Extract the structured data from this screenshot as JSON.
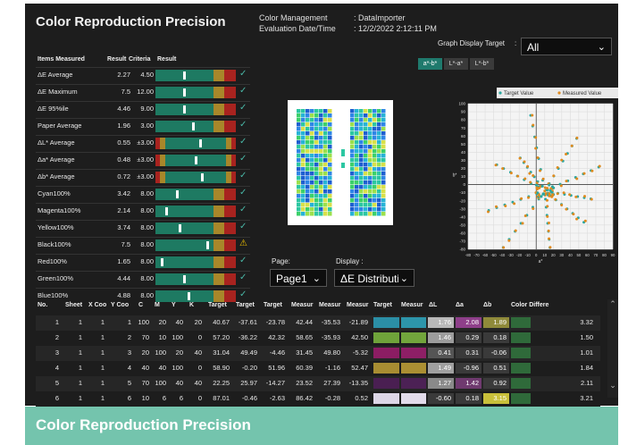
{
  "title": "Color Reproduction Precision",
  "header": {
    "color_management_label": "Color Management",
    "color_management_value": ": DataImporter",
    "evaluation_label": "Evaluation Date/Time",
    "evaluation_value": ": 12/2/2022 2:12:11 PM",
    "graph_target_label": "Graph Display Target",
    "graph_target_colon": ":",
    "graph_target_value": "All"
  },
  "graph_tabs": [
    "a*-b*",
    "L*-a*",
    "L*-b*"
  ],
  "measured_table": {
    "columns": [
      "Items Measured",
      "Result",
      "Criteria",
      "Result"
    ],
    "rows": [
      {
        "label": "ΔE Average",
        "result": "2.27",
        "criteria": "4.50",
        "pos": 0.36,
        "status": "✓"
      },
      {
        "label": "ΔE Maximum",
        "result": "7.5",
        "criteria": "12.00",
        "pos": 0.36,
        "status": "✓"
      },
      {
        "label": "ΔE 95%ile",
        "result": "4.46",
        "criteria": "9.00",
        "pos": 0.36,
        "status": "✓"
      },
      {
        "label": "Paper Average",
        "result": "1.96",
        "criteria": "3.00",
        "pos": 0.47,
        "status": "✓"
      },
      {
        "label": "ΔL* Average",
        "result": "0.55",
        "criteria": "±3.00",
        "pos": 0.55,
        "status": "✓"
      },
      {
        "label": "Δa* Average",
        "result": "0.48",
        "criteria": "±3.00",
        "pos": 0.5,
        "status": "✓"
      },
      {
        "label": "Δb* Average",
        "result": "0.72",
        "criteria": "±3.00",
        "pos": 0.58,
        "status": "✓"
      },
      {
        "label": "Cyan100%",
        "result": "3.42",
        "criteria": "8.00",
        "pos": 0.27,
        "status": "✓"
      },
      {
        "label": "Magenta100%",
        "result": "2.14",
        "criteria": "8.00",
        "pos": 0.13,
        "status": "✓"
      },
      {
        "label": "Yellow100%",
        "result": "3.74",
        "criteria": "8.00",
        "pos": 0.3,
        "status": "✓"
      },
      {
        "label": "Black100%",
        "result": "7.5",
        "criteria": "8.00",
        "pos": 0.64,
        "status": "⚠"
      },
      {
        "label": "Red100%",
        "result": "1.65",
        "criteria": "8.00",
        "pos": 0.08,
        "status": "✓"
      },
      {
        "label": "Green100%",
        "result": "4.44",
        "criteria": "8.00",
        "pos": 0.36,
        "status": "✓"
      },
      {
        "label": "Blue100%",
        "result": "4.88",
        "criteria": "8.00",
        "pos": 0.41,
        "status": "✓"
      }
    ]
  },
  "page_selector": {
    "label": "Page:",
    "value": "Page1"
  },
  "display_selector": {
    "label": "Display :",
    "value": "ΔE Distributio"
  },
  "chart_data": {
    "type": "scatter",
    "series": [
      {
        "name": "Target Value",
        "color": "#2aa7a0"
      },
      {
        "name": "Measured Value",
        "color": "#e08a1e"
      }
    ],
    "xlim": [
      -80,
      90
    ],
    "ylim": [
      -80,
      100
    ],
    "xticks": [
      "-80",
      "-70",
      "-60",
      "-50",
      "-40",
      "-30",
      "-20",
      "-10",
      "0",
      "10",
      "20",
      "30",
      "40",
      "50",
      "60",
      "70",
      "80",
      "90"
    ],
    "yticks": [
      "100",
      "90",
      "80",
      "70",
      "60",
      "50",
      "40",
      "30",
      "20",
      "10",
      "0",
      "-10",
      "-20",
      "-30",
      "-40",
      "-50",
      "-60",
      "-70",
      "-80"
    ],
    "xlabel": "a*",
    "ylabel": "b*",
    "grid": true,
    "legend": "top",
    "rays": [
      {
        "angle": 100,
        "len": 95
      },
      {
        "angle": 60,
        "len": 75
      },
      {
        "angle": 25,
        "len": 70
      },
      {
        "angle": 150,
        "len": 65
      },
      {
        "angle": 200,
        "len": 70
      },
      {
        "angle": 235,
        "len": 85
      },
      {
        "angle": 275,
        "len": 70
      },
      {
        "angle": 320,
        "len": 60
      },
      {
        "angle": -10,
        "len": 55
      },
      {
        "angle": 125,
        "len": 50
      }
    ]
  },
  "bottom_table": {
    "columns": [
      "No.",
      "Sheet",
      "X Coo",
      "Y Coo",
      "C",
      "M",
      "Y",
      "K",
      "Target",
      "Target",
      "Target",
      "Measur",
      "Measur",
      "Measur",
      "Target",
      "Measur",
      "ΔL",
      "Δa",
      "Δb",
      "Color Differe"
    ],
    "rows": [
      {
        "no": "1",
        "sheet": "1",
        "x": "1",
        "y": "1",
        "c": "100",
        "m": "20",
        "yv": "40",
        "k": "20",
        "tL": "40.67",
        "ta": "-37.61",
        "tb": "-23.78",
        "mL": "42.44",
        "ma": "-35.53",
        "mb": "-21.89",
        "tcol": "#2b8fa6",
        "mcol": "#2d95aa",
        "dL": "1.76",
        "da": "2.08",
        "db": "1.89",
        "de": "3.32",
        "dLc": "#b9b9b9",
        "dac": "#8e3f8a",
        "dbc": "#8f8a3a"
      },
      {
        "no": "2",
        "sheet": "1",
        "x": "1",
        "y": "2",
        "c": "70",
        "m": "10",
        "yv": "100",
        "k": "0",
        "tL": "57.20",
        "ta": "-36.22",
        "tb": "42.32",
        "mL": "58.65",
        "ma": "-35.93",
        "mb": "42.50",
        "tcol": "#6fa33a",
        "mcol": "#72a53c",
        "dL": "1.46",
        "da": "0.29",
        "db": "0.18",
        "de": "1.50",
        "dLc": "#9d9d9d",
        "dac": "#3a3a3a",
        "dbc": "#3a3a3a"
      },
      {
        "no": "3",
        "sheet": "1",
        "x": "1",
        "y": "3",
        "c": "20",
        "m": "100",
        "yv": "20",
        "k": "40",
        "tL": "31.04",
        "ta": "49.49",
        "tb": "-4.46",
        "mL": "31.45",
        "ma": "49.80",
        "mb": "-5.32",
        "tcol": "#8c1d63",
        "mcol": "#8e1f66",
        "dL": "0.41",
        "da": "0.31",
        "db": "-0.06",
        "de": "1.01",
        "dLc": "#555",
        "dac": "#3a3a3a",
        "dbc": "#3a3a3a"
      },
      {
        "no": "4",
        "sheet": "1",
        "x": "1",
        "y": "4",
        "c": "40",
        "m": "40",
        "yv": "100",
        "k": "0",
        "tL": "58.90",
        "ta": "-0.20",
        "tb": "51.96",
        "mL": "60.39",
        "ma": "-1.16",
        "mb": "52.47",
        "tcol": "#a88d32",
        "mcol": "#ab8f33",
        "dL": "1.49",
        "da": "-0.96",
        "db": "0.51",
        "de": "1.84",
        "dLc": "#a0a0a0",
        "dac": "#3a3a3a",
        "dbc": "#3a3a3a"
      },
      {
        "no": "5",
        "sheet": "1",
        "x": "1",
        "y": "5",
        "c": "70",
        "m": "100",
        "yv": "40",
        "k": "40",
        "tL": "22.25",
        "ta": "25.97",
        "tb": "-14.27",
        "mL": "23.52",
        "ma": "27.39",
        "mb": "-13.35",
        "tcol": "#4a1f52",
        "mcol": "#4c2155",
        "dL": "1.27",
        "da": "1.42",
        "db": "0.92",
        "de": "2.11",
        "dLc": "#8a8a8a",
        "dac": "#6f3a6f",
        "dbc": "#3a3a3a"
      },
      {
        "no": "6",
        "sheet": "1",
        "x": "1",
        "y": "6",
        "c": "10",
        "m": "6",
        "yv": "6",
        "k": "0",
        "tL": "87.01",
        "ta": "-0.46",
        "tb": "-2.63",
        "mL": "86.42",
        "ma": "-0.28",
        "mb": "0.52",
        "tcol": "#ddd6e6",
        "mcol": "#e2dbea",
        "dL": "-0.60",
        "da": "0.18",
        "db": "3.15",
        "de": "3.21",
        "dLc": "#3a3a3a",
        "dac": "#3a3a3a",
        "dbc": "#c8bf3a"
      }
    ]
  },
  "caption": "Color Reproduction Precision"
}
